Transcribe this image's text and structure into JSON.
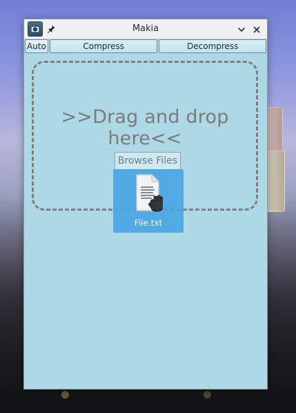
{
  "window": {
    "title": "Makia"
  },
  "toolbar": {
    "auto_label": "Auto",
    "compress_label": "Compress",
    "decompress_label": "Decompress"
  },
  "main": {
    "drop_text": ">>Drag and drop here<<",
    "browse_label": "Browse Files",
    "dragging_file_label": "File.txt"
  },
  "colors": {
    "window_bg": "#add8e6",
    "drag_highlight": "#4aa7e3",
    "dashed_border": "#7f7f7f"
  },
  "icons": {
    "app": "camera-icon",
    "pin": "pin-icon",
    "minimize": "chevron-down-icon",
    "close": "close-icon",
    "file": "document-icon",
    "cursor": "hand-cursor-icon"
  }
}
